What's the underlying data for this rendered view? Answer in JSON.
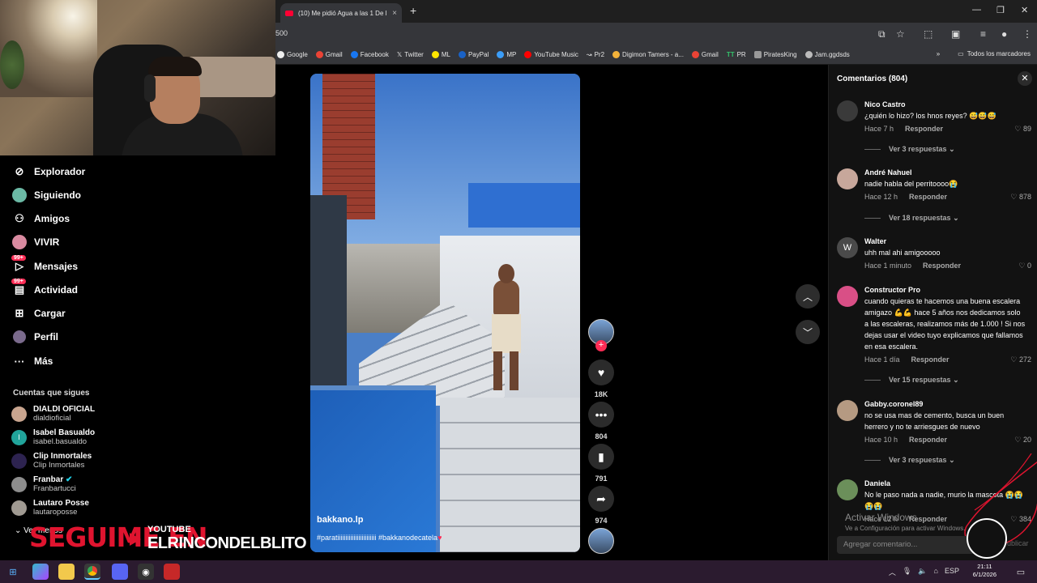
{
  "browser": {
    "tab_title": "(10) Me pidió Agua a las 1 De l",
    "url_fragment": "500",
    "bookmarks": [
      "Google",
      "Gmail",
      "Facebook",
      "Twitter",
      "ML",
      "PayPal",
      "MP",
      "YouTube Music",
      "Pr2",
      "Digimon Tamers - a...",
      "Gmail",
      "PR",
      "PiratesKing",
      "Jam.ggdsds"
    ],
    "all_bookmarks_label": "Todos los marcadores"
  },
  "sidebar": {
    "items": [
      {
        "label": "Explorador",
        "icon": "compass-icon"
      },
      {
        "label": "Siguiendo",
        "icon": "following-icon"
      },
      {
        "label": "Amigos",
        "icon": "friends-icon"
      },
      {
        "label": "VIVIR",
        "icon": "live-icon"
      },
      {
        "label": "Mensajes",
        "icon": "messages-icon",
        "badge": "99+"
      },
      {
        "label": "Actividad",
        "icon": "activity-icon",
        "badge": "99+"
      },
      {
        "label": "Cargar",
        "icon": "upload-icon"
      },
      {
        "label": "Perfil",
        "icon": "profile-icon"
      },
      {
        "label": "Más",
        "icon": "more-icon"
      }
    ],
    "following_title": "Cuentas que sigues",
    "accounts": [
      {
        "name": "DIALDI OFICIAL",
        "handle": "dialdioficial"
      },
      {
        "name": "Isabel Basualdo",
        "handle": "isabel.basualdo"
      },
      {
        "name": "Clip Inmortales",
        "handle": "Clip Inmortales"
      },
      {
        "name": "Franbar",
        "handle": "Franbartucci"
      },
      {
        "name": "Lautaro Posse",
        "handle": "lautaroposse"
      }
    ],
    "see_less": "Ver menos"
  },
  "overlay": {
    "seguime": "SEGUIME EN",
    "platform": "YOUTUBE",
    "channel": "ELRINCONDELBLITO"
  },
  "video": {
    "username": "bakkano.lp",
    "description": "#paratiiiiiiiiiiiiiiiiiiiiiiii #bakkanodecatela",
    "likes": "18K",
    "comments": "804",
    "saves": "791",
    "shares": "974"
  },
  "comments": {
    "header": "Comentarios (804)",
    "reply_label": "Responder",
    "items": [
      {
        "name": "Nico Castro",
        "text": "¿quién lo hizo? los hnos reyes? 😅😅😅",
        "time": "Hace 7 h",
        "likes": "89",
        "replies": "Ver 3 respuestas"
      },
      {
        "name": "André Nahuel",
        "text": "nadie habla del perritoooo😭",
        "time": "Hace 12 h",
        "likes": "878",
        "replies": "Ver 18 respuestas"
      },
      {
        "name": "Walter",
        "text": "uhh mal ahi amigooooo",
        "time": "Hace 1 minuto",
        "likes": "0",
        "replies": "",
        "initial": "W"
      },
      {
        "name": "Constructor Pro",
        "text": "cuando quieras te hacemos una buena escalera amigazo 💪💪 hace 5 años nos dedicamos solo a las escaleras, realizamos más de 1.000 ! Si nos dejas usar el video tuyo explicamos que fallamos en esa escalera.",
        "time": "Hace 1 día",
        "likes": "272",
        "replies": "Ver 15 respuestas"
      },
      {
        "name": "Gabby.coronel89",
        "text": "no se usa mas de cemento, busca un buen herrero y no te arriesgues de nuevo",
        "time": "Hace 10 h",
        "likes": "20",
        "replies": "Ver 3 respuestas"
      },
      {
        "name": "Daniela",
        "text": "No le paso nada a nadie, murio la mascota 😭😭😭😭",
        "time": "Hace 12 h",
        "likes": "384",
        "replies": ""
      }
    ],
    "input_placeholder": "Agregar comentario...",
    "publish_label": "Publicar",
    "activate_windows": "Activar Windows",
    "activate_windows_sub": "Ve a Configuración para activar Windows."
  },
  "taskbar": {
    "lang": "ESP",
    "time": "21:11",
    "date": "6/1/2026"
  }
}
